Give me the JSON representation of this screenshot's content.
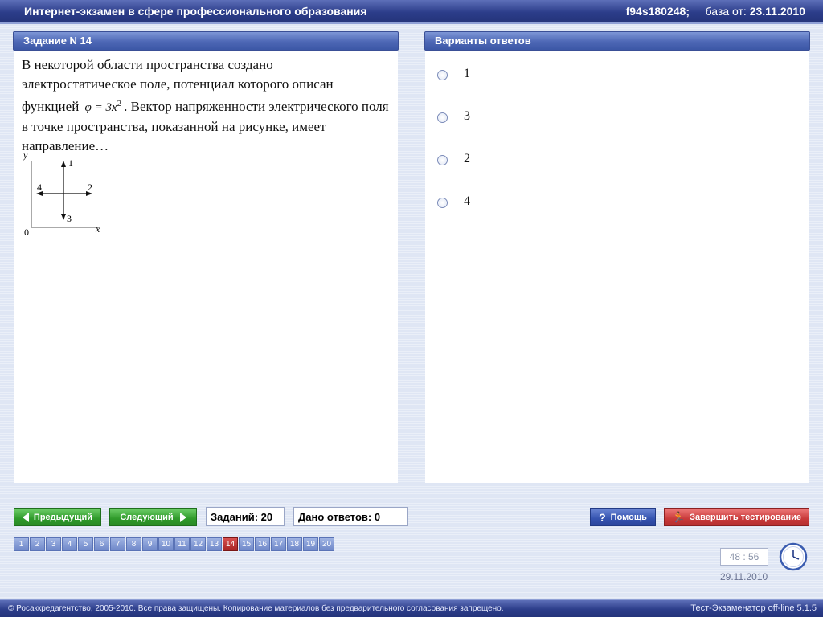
{
  "header": {
    "title": "Интернет-экзамен в сфере профессионального образования",
    "session_id": "f94s180248;",
    "db_label": "база от:",
    "db_date": "23.11.2010"
  },
  "question": {
    "header": "Задание N 14",
    "text_part1": "В некоторой области пространства создано электростатическое поле, потенциал которого описан функцией",
    "formula_lhs": "φ = 3x",
    "formula_exp": "2",
    "text_part2": ". Вектор напряженности электрического поля в точке пространства, показанной на рисунке, имеет направление…",
    "figure": {
      "axis_y": "y",
      "axis_x": "x",
      "origin": "0",
      "dir_up": "1",
      "dir_right": "2",
      "dir_down": "3",
      "dir_left": "4"
    }
  },
  "answers": {
    "header": "Варианты ответов",
    "options": [
      "1",
      "3",
      "2",
      "4"
    ]
  },
  "nav": {
    "prev_label": "Предыдущий",
    "next_label": "Следующий",
    "total_label": "Заданий: 20",
    "answered_label": "Дано ответов: 0",
    "help_label": "Помощь",
    "finish_label": "Завершить тестирование",
    "question_numbers": [
      "1",
      "2",
      "3",
      "4",
      "5",
      "6",
      "7",
      "8",
      "9",
      "10",
      "11",
      "12",
      "13",
      "14",
      "15",
      "16",
      "17",
      "18",
      "19",
      "20"
    ],
    "current": "14"
  },
  "timer": {
    "value": "48 : 56",
    "date": "29.11.2010"
  },
  "footer": {
    "copyright": "© Росаккредагентство, 2005-2010. Все права защищены. Копирование материалов без предварительного согласования запрещено.",
    "version": "Тест-Экзаменатор off-line 5.1.5"
  },
  "colors": {
    "header_blue": "#2c3d8a",
    "nav_green": "#2f9a2a",
    "help_blue": "#3553b0",
    "finish_red": "#c93a3a",
    "active_question": "#a82424"
  }
}
